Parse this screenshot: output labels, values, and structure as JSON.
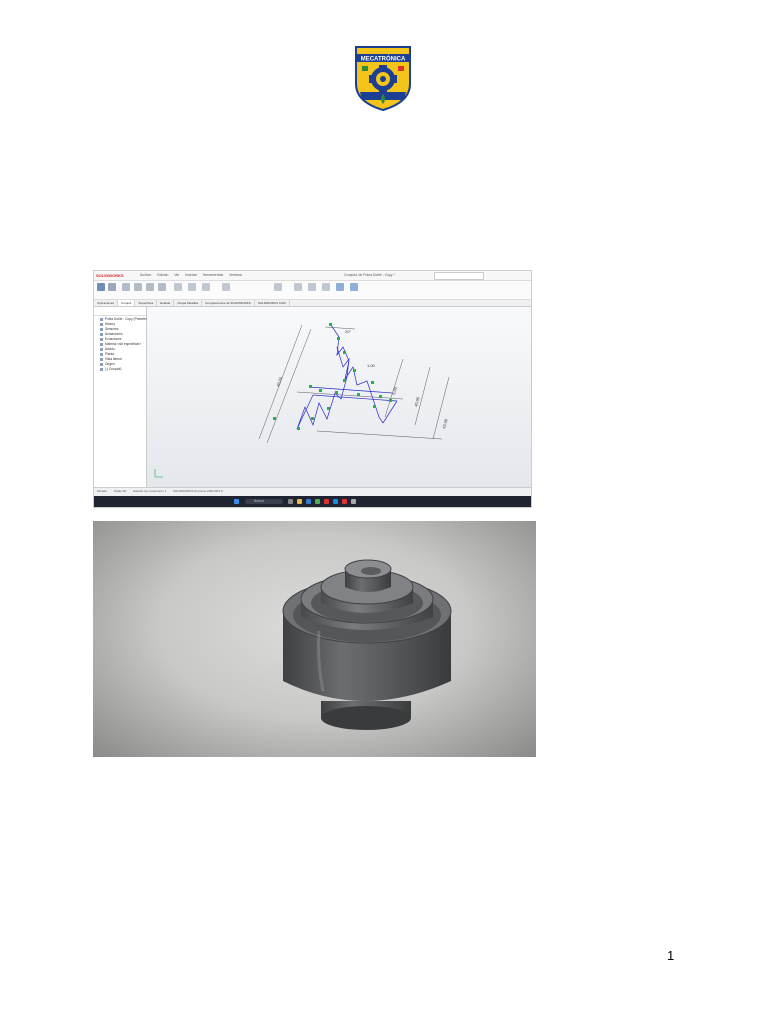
{
  "logo": {
    "text": "MECATRÓNICA",
    "colors": {
      "field": "#f3c41a",
      "border": "#1c3f94",
      "gear": "#1c3f94",
      "leaf": "#2e8b3a"
    }
  },
  "solidworks_screenshot": {
    "app_logo": "SOLIDWORKS",
    "menu": [
      "Archivo",
      "Edición",
      "Ver",
      "Insertar",
      "Herramientas",
      "Ventana"
    ],
    "document_title": "Croquis1 de Polea Doble - Copy *",
    "search_placeholder": "",
    "tabs": [
      "Operaciones",
      "Croquis",
      "Superficies",
      "Evaluar",
      "Chapa Metálica",
      "Complementos de SOLIDWORKS",
      "SOLIDWORKS CAM"
    ],
    "tree_items": [
      "Polea Doble - Copy (Predeterminado)",
      "History",
      "Sensores",
      "Anotaciones",
      "Ecuaciones",
      "Material <sin especificar>",
      "Alzado",
      "Planta",
      "Vista lateral",
      "Origen",
      "(-) Croquis1"
    ],
    "status_tabs": [
      "Modelo",
      "Vistas 3D",
      "Estudio de movimiento 1"
    ],
    "status_text": "SOLIDWORKS Premium 2023 SP1.0",
    "dimensions": [
      "40.00",
      "40.00",
      "5.00",
      "43.00",
      "20°",
      "1.00"
    ],
    "taskbar_search": "Buscar",
    "colors": {
      "sketch_line": "#2a2ac8",
      "relation": "#22b14c",
      "dimension": "#333333"
    }
  },
  "render_photo": {
    "colors": {
      "body": "#5d5f62",
      "highlight": "#8c8e91",
      "shadow": "#3a3b3d"
    }
  },
  "page_number": "1"
}
